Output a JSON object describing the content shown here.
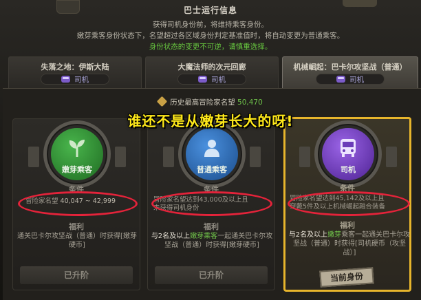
{
  "header": {
    "title": "巴士运行信息",
    "desc1": "获得司机身份前，将维持乘客身份。",
    "desc2": "嫩芽乘客身份状态下，名望超过各区域身份判定基准值时，将自动变更为普通乘客。",
    "warn": "身份状态的变更不可逆，请慎重选择。"
  },
  "tabs": [
    {
      "title": "失落之地：伊斯大陆",
      "role": "司机",
      "active": false
    },
    {
      "title": "大魔法师的次元回廊",
      "role": "司机",
      "active": false
    },
    {
      "title": "机械崛起：巴卡尔攻坚战（普通）",
      "role": "司机",
      "active": true
    }
  ],
  "fame": {
    "label": "历史最高冒险家名望",
    "value": "50,470"
  },
  "banner": "谁还不是从嫩芽长大的呀!",
  "cards": [
    {
      "role": "嫩芽乘客",
      "color": "#2f8a34",
      "icon": "sprout-icon",
      "cond_title": "条件",
      "cond_label": "冒险家名望",
      "cond_value": "40,047 ~ 42,999",
      "cond_extra": "",
      "benefit_title": "福利",
      "benefit": "通关巴卡尔攻坚战（普通）时获得[嫩芽硬币]",
      "footer": "已升阶"
    },
    {
      "role": "普通乘客",
      "color": "#2e6fb9",
      "icon": "person-icon",
      "cond_title": "条件",
      "cond_label": "冒险家名望达到43,000及以上且",
      "cond_value": "",
      "cond_extra": "未获得司机身份",
      "benefit_title": "福利",
      "benefit_pre": "与2名及以上",
      "benefit_hl": "嫩芽乘客",
      "benefit_post": "一起通关巴卡尔攻坚战（普通）时获得[嫩芽硬币]",
      "footer": "已升阶"
    },
    {
      "role": "司机",
      "color": "#7b43c9",
      "icon": "bus-icon",
      "cond_title": "条件",
      "cond_label": "冒险家名望达到45,142及以上且",
      "cond_value": "",
      "cond_extra": "穿戴5件及以上机械崛起融合装备",
      "benefit_title": "福利",
      "benefit_pre": "与2名及以上",
      "benefit_hl": "嫩芽",
      "benefit_post": "乘客一起通关巴卡尔攻坚战（普通）时获得[司机硬币（攻坚战）]",
      "footer": "当前身份"
    }
  ]
}
